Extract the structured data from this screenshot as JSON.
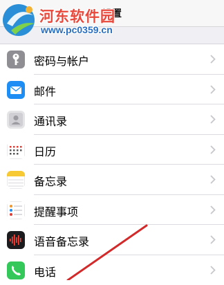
{
  "header": {
    "title": "设置"
  },
  "watermark": {
    "name": "河东软件园",
    "url": "www.pc0359.cn"
  },
  "settings": [
    {
      "label": "密码与帐户",
      "icon": "key-icon"
    },
    {
      "label": "邮件",
      "icon": "mail-icon"
    },
    {
      "label": "通讯录",
      "icon": "contacts-icon"
    },
    {
      "label": "日历",
      "icon": "calendar-icon"
    },
    {
      "label": "备忘录",
      "icon": "notes-icon"
    },
    {
      "label": "提醒事项",
      "icon": "reminders-icon"
    },
    {
      "label": "语音备忘录",
      "icon": "voice-memo-icon"
    },
    {
      "label": "电话",
      "icon": "phone-icon"
    }
  ],
  "colors": {
    "annotation_line": "#d22a2a",
    "watermark_red": "#e8493c",
    "watermark_blue": "#2a6fbf"
  }
}
